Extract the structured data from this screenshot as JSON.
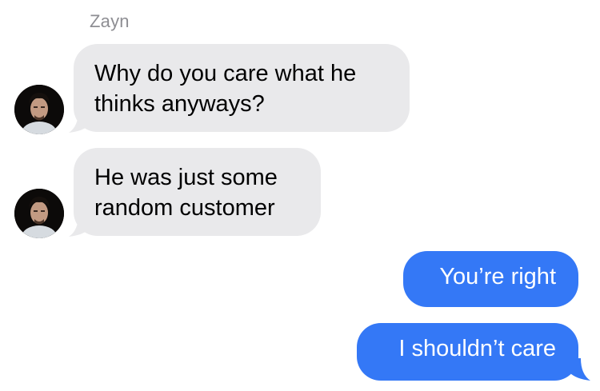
{
  "conversation": {
    "sender_name": "Zayn",
    "incoming": [
      {
        "text": "Why do you care what he\nthinks anyways?",
        "avatar": "avatar-photo"
      },
      {
        "text": "He was just some\nrandom customer",
        "avatar": "avatar-photo"
      }
    ],
    "outgoing": [
      {
        "text": "You’re right"
      },
      {
        "text": "I shouldn’t care"
      }
    ]
  },
  "colors": {
    "incoming_bubble": "#e9e9eb",
    "outgoing_bubble": "#3478f6",
    "sender_name": "#8e8e93"
  }
}
